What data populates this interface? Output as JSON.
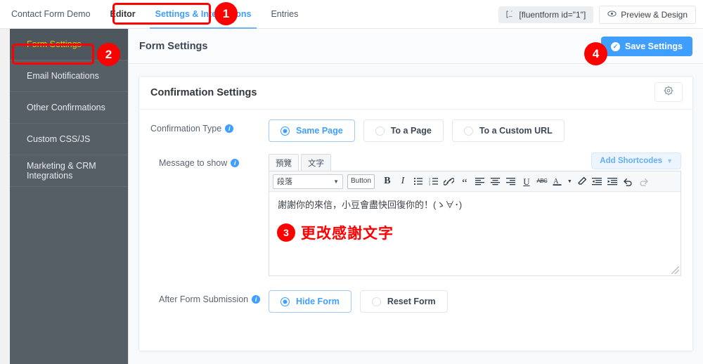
{
  "topbar": {
    "form_title": "Contact Form Demo",
    "tabs": [
      {
        "label": "Editor",
        "active": false
      },
      {
        "label": "Settings & Integrations",
        "active": true
      },
      {
        "label": "Entries",
        "active": false
      }
    ],
    "shortcode_chip": "[fluentform id=\"1\"]",
    "shortcode_icon": "shortcode-icon",
    "preview_button": "Preview & Design",
    "preview_icon": "eye-icon"
  },
  "sidebar": {
    "items": [
      {
        "label": "Form Settings",
        "active": true
      },
      {
        "label": "Email Notifications",
        "active": false
      },
      {
        "label": "Other Confirmations",
        "active": false
      },
      {
        "label": "Custom CSS/JS",
        "active": false
      },
      {
        "label": "Marketing & CRM Integrations",
        "active": false
      }
    ]
  },
  "main": {
    "page_title": "Form Settings",
    "save_button": "Save Settings",
    "save_icon": "check-circle-icon"
  },
  "card": {
    "title": "Confirmation Settings",
    "gear_icon": "gear-icon",
    "rows": {
      "confirmation_type": {
        "label": "Confirmation Type",
        "info_icon": "info-icon",
        "options": [
          {
            "label": "Same Page",
            "selected": true
          },
          {
            "label": "To a Page",
            "selected": false
          },
          {
            "label": "To a Custom URL",
            "selected": false
          }
        ]
      },
      "message_to_show": {
        "label": "Message to show",
        "info_icon": "info-icon",
        "editor_tabs": [
          {
            "label": "預覽",
            "active": true
          },
          {
            "label": "文字",
            "active": false
          }
        ],
        "add_shortcodes": "Add Shortcodes",
        "add_shortcodes_chevron": "chevron-down-icon",
        "toolbar": {
          "format_select": "段落",
          "button_tool": "Button",
          "tools": [
            "bold-icon",
            "italic-icon",
            "bulleted-list-icon",
            "numbered-list-icon",
            "link-icon",
            "blockquote-icon",
            "align-left-icon",
            "align-center-icon",
            "align-right-icon",
            "underline-icon",
            "strikethrough-icon",
            "text-color-icon",
            "color-dropdown-icon",
            "clear-formatting-icon",
            "outdent-icon",
            "indent-icon",
            "undo-icon",
            "redo-icon"
          ]
        },
        "content_text": "謝謝你的來信，小豆會盡快回復你的！(ゝ∀･)",
        "annotation_text": "更改感謝文字"
      },
      "after_submission": {
        "label": "After Form Submission",
        "info_icon": "info-icon",
        "options": [
          {
            "label": "Hide Form",
            "selected": true
          },
          {
            "label": "Reset Form",
            "selected": false
          }
        ]
      }
    }
  },
  "annotations": {
    "badge1": "1",
    "badge2": "2",
    "badge3": "3",
    "badge4": "4",
    "color": "#ff0000"
  },
  "colors": {
    "accent": "#409eff",
    "sidebar_bg": "#565e66",
    "sidebar_active_text": "#f2c200",
    "annotation_red": "#ff0000"
  }
}
